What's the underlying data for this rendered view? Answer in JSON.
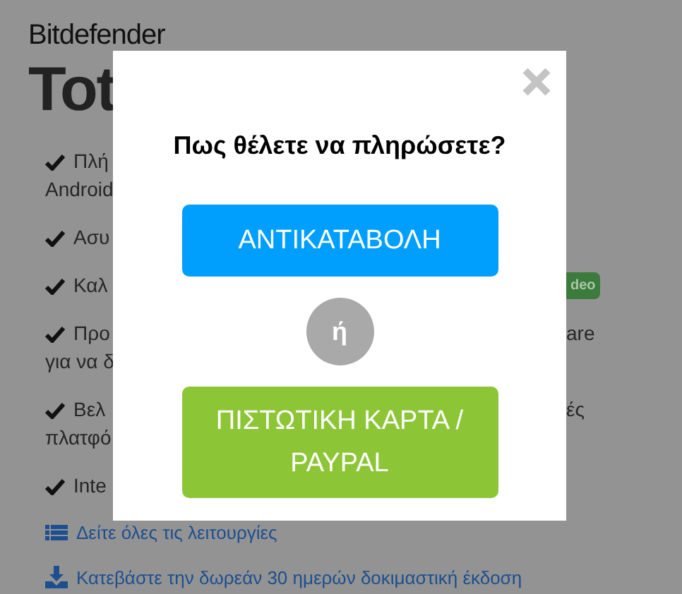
{
  "page": {
    "brand": "Bitdefender",
    "product": "Tot",
    "features": [
      {
        "lines": [
          {
            "left": "Πλή"
          },
          {
            "left": "Android"
          }
        ]
      },
      {
        "lines": [
          {
            "left": "Ασυ"
          }
        ]
      },
      {
        "lines": [
          {
            "left": "Καλ",
            "right": "deo",
            "kind": "badge"
          }
        ]
      },
      {
        "lines": [
          {
            "left": "Προ",
            "right": "are"
          },
          {
            "left": "για να δ"
          }
        ]
      },
      {
        "lines": [
          {
            "left": "Βελ",
            "right": "ές"
          },
          {
            "left": "πλατφό"
          }
        ]
      },
      {
        "lines": [
          {
            "left": "Inte"
          }
        ]
      }
    ],
    "links": [
      {
        "kind": "list",
        "text": "Δείτε όλες τις λειτουργίες"
      },
      {
        "kind": "download",
        "text": "Κατεβάστε την δωρεάν 30 ημερών δοκιμαστική έκδοση"
      }
    ]
  },
  "dialog": {
    "title": "Πως θέλετε να πληρώσετε?",
    "options": [
      {
        "label": "ΑΝΤΙΚΑΤΑΒΟΛΗ",
        "color": "#009ffd"
      },
      {
        "label": "ΠΙΣΤΩΤΙΚΗ ΚΑΡΤΑ / PAYPAL",
        "color": "#8cc636"
      }
    ],
    "separator": "ή"
  }
}
